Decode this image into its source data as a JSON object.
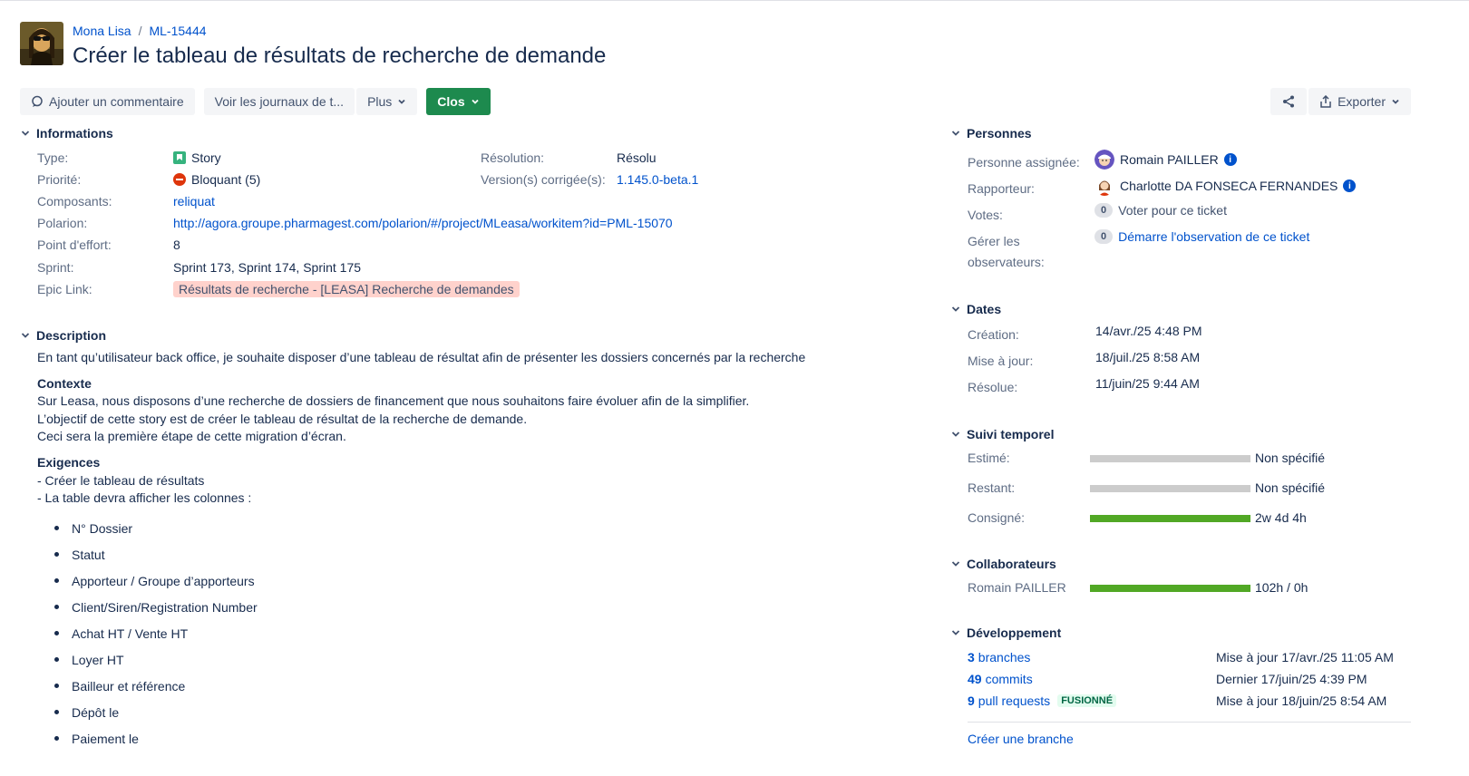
{
  "header": {
    "project": "Mona Lisa",
    "issue_key": "ML-15444",
    "title": "Créer le tableau de résultats de recherche de demande"
  },
  "toolbar": {
    "comment_label": "Ajouter un commentaire",
    "logs_label": "Voir les journaux de t...",
    "more_label": "Plus",
    "status_label": "Clos",
    "export_label": "Exporter"
  },
  "details": {
    "heading": "Informations",
    "type_label": "Type:",
    "type_value": "Story",
    "priority_label": "Priorité:",
    "priority_value": "Bloquant (5)",
    "components_label": "Composants:",
    "components_value": "reliquat",
    "polarion_label": "Polarion:",
    "polarion_value": "http://agora.groupe.pharmagest.com/polarion/#/project/MLeasa/workitem?id=PML-15070",
    "effort_label": "Point d'effort:",
    "effort_value": "8",
    "sprint_label": "Sprint:",
    "sprint_value": "Sprint 173, Sprint 174, Sprint 175",
    "epic_label": "Epic Link:",
    "epic_value": "Résultats de recherche - [LEASA] Recherche de demandes",
    "resolution_label": "Résolution:",
    "resolution_value": "Résolu",
    "fix_version_label": "Version(s) corrigée(s):",
    "fix_version_value": "1.145.0-beta.1"
  },
  "description": {
    "heading": "Description",
    "intro": "En tant qu’utilisateur back office, je souhaite disposer d’une tableau de résultat afin de présenter les dossiers concernés par la recherche",
    "context_heading": "Contexte",
    "context_lines": [
      "Sur Leasa, nous disposons d’une recherche de dossiers de financement que nous souhaitons faire évoluer afin de la simplifier.",
      "L’objectif de cette story est de créer le tableau de résultat de la recherche de demande.",
      "Ceci sera la première étape de cette migration d’écran."
    ],
    "requirements_heading": "Exigences",
    "requirements_lines": [
      "- Créer le tableau de résultats",
      "- La table devra afficher les colonnes :"
    ],
    "columns": [
      "N° Dossier",
      "Statut",
      "Apporteur / Groupe d’apporteurs",
      "Client/Siren/Registration Number",
      "Achat HT / Vente HT",
      "Loyer HT",
      "Bailleur et référence",
      "Dépôt le",
      "Paiement le"
    ]
  },
  "people": {
    "heading": "Personnes",
    "assignee_label": "Personne assignée:",
    "assignee_value": "Romain PAILLER",
    "reporter_label": "Rapporteur:",
    "reporter_value": "Charlotte DA FONSECA FERNANDES",
    "votes_label": "Votes:",
    "votes_count": "0",
    "votes_action": "Voter pour ce ticket",
    "watchers_label_1": "Gérer les",
    "watchers_label_2": "observateurs:",
    "watchers_count": "0",
    "watchers_action": "Démarre l'observation de ce ticket"
  },
  "dates": {
    "heading": "Dates",
    "created_label": "Création:",
    "created_value": "14/avr./25 4:48 PM",
    "updated_label": "Mise à jour:",
    "updated_value": "18/juil./25 8:58 AM",
    "resolved_label": "Résolue:",
    "resolved_value": "11/juin/25 9:44 AM"
  },
  "time_tracking": {
    "heading": "Suivi temporel",
    "estimated_label": "Estimé:",
    "estimated_value": "Non spécifié",
    "remaining_label": "Restant:",
    "remaining_value": "Non spécifié",
    "logged_label": "Consigné:",
    "logged_value": "2w 4d 4h",
    "logged_fraction": 1.0
  },
  "collaborators": {
    "heading": "Collaborateurs",
    "name": "Romain PAILLER",
    "value": "102h / 0h",
    "fraction": 1.0
  },
  "development": {
    "heading": "Développement",
    "branches_count": "3",
    "branches_label": "branches",
    "branches_meta": "Mise à jour 17/avr./25 11:05 AM",
    "commits_count": "49",
    "commits_label": "commits",
    "commits_meta": "Dernier 17/juin/25 4:39 PM",
    "prs_count": "9",
    "prs_label": "pull requests",
    "prs_badge": "FUSIONNÉ",
    "prs_meta": "Mise à jour 18/juin/25 8:54 AM",
    "create_branch": "Créer une branche"
  },
  "colors": {
    "primary_link": "#0052cc",
    "status_green": "#1d8a4e",
    "progress_green": "#51a825",
    "epic_bg": "#ffd2cc"
  }
}
